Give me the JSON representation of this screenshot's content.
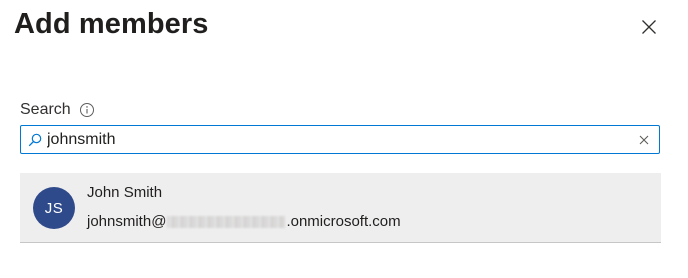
{
  "dialog": {
    "title": "Add members",
    "close_icon": "close-icon"
  },
  "search": {
    "label": "Search",
    "info_icon": "info-icon",
    "value": "johnsmith",
    "search_icon": "search-icon",
    "clear_icon": "clear-icon"
  },
  "results": [
    {
      "initials": "JS",
      "name": "John Smith",
      "email_prefix": "johnsmith@",
      "email_suffix": ".onmicrosoft.com",
      "avatar_color": "#2f4a8b"
    }
  ],
  "colors": {
    "accent": "#0078d4",
    "result_background": "#efeeee"
  }
}
